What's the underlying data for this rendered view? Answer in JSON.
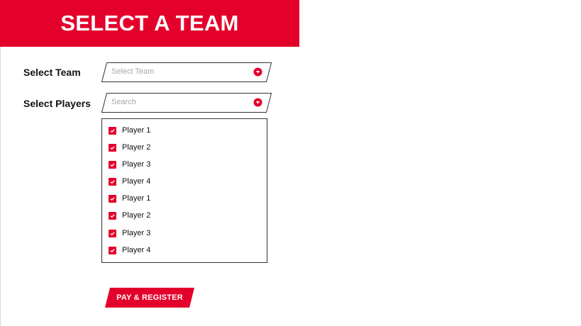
{
  "header": {
    "title": "SELECT A TEAM"
  },
  "team_field": {
    "label": "Select Team",
    "placeholder": "Select Team",
    "caret_icon": "chevron-down-icon"
  },
  "players_field": {
    "label": "Select Players",
    "placeholder": "Search",
    "caret_icon": "chevron-down-icon"
  },
  "players": [
    {
      "label": "Player 1",
      "checked": true
    },
    {
      "label": "Player 2",
      "checked": true
    },
    {
      "label": "Player 3",
      "checked": true
    },
    {
      "label": "Player 4",
      "checked": true
    },
    {
      "label": "Player 1",
      "checked": true
    },
    {
      "label": "Player 2",
      "checked": true
    },
    {
      "label": "Player 3",
      "checked": true
    },
    {
      "label": "Player 4",
      "checked": true
    }
  ],
  "actions": {
    "pay_register_label": "PAY & REGISTER"
  },
  "colors": {
    "accent": "#e3002b",
    "placeholder": "#a6a6a6",
    "text": "#111111"
  }
}
